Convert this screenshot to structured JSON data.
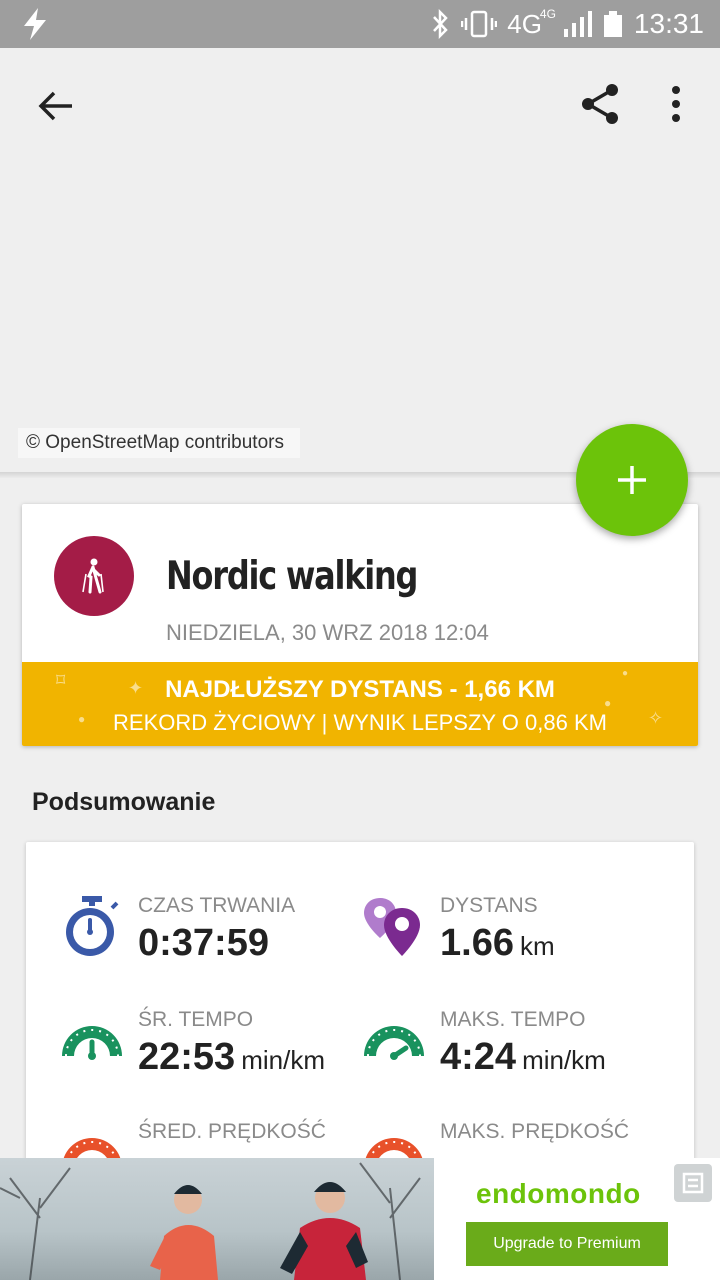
{
  "status_bar": {
    "network": "4G",
    "network_sub": "4G",
    "time": "13:31"
  },
  "toolbar": {
    "back_icon": "arrow-back-icon",
    "share_icon": "share-icon",
    "more_icon": "more-vert-icon"
  },
  "map": {
    "attribution": "© OpenStreetMap contributors"
  },
  "fab": {
    "icon": "plus-icon",
    "color": "#6cc30a"
  },
  "activity": {
    "sport": "Nordic walking",
    "date": "NIEDZIELA, 30 WRZ 2018 12:04",
    "icon_color": "#a41c47",
    "record_line1": "NAJDŁUŻSZY DYSTANS  -  1,66 KM",
    "record_line2": "REKORD ŻYCIOWY  |  WYNIK LEPSZY O 0,86 KM",
    "record_color": "#f1b400"
  },
  "summary": {
    "heading": "Podsumowanie",
    "stats": [
      {
        "label": "CZAS TRWANIA",
        "value": "0:37:59",
        "unit": "",
        "icon": "stopwatch-icon"
      },
      {
        "label": "DYSTANS",
        "value": "1.66",
        "unit": "km",
        "icon": "location-pins-icon"
      },
      {
        "label": "ŚR. TEMPO",
        "value": "22:53",
        "unit": "min/km",
        "icon": "speedometer-icon"
      },
      {
        "label": "MAKS. TEMPO",
        "value": "4:24",
        "unit": "min/km",
        "icon": "speedometer-icon"
      },
      {
        "label": "ŚRED. PRĘDKOŚĆ",
        "value": "",
        "unit": "",
        "icon": "speedometer-icon"
      },
      {
        "label": "MAKS. PRĘDKOŚĆ",
        "value": "",
        "unit": "",
        "icon": "speedometer-icon"
      }
    ]
  },
  "ad": {
    "brand": "endomondo",
    "cta": "Upgrade to Premium"
  }
}
